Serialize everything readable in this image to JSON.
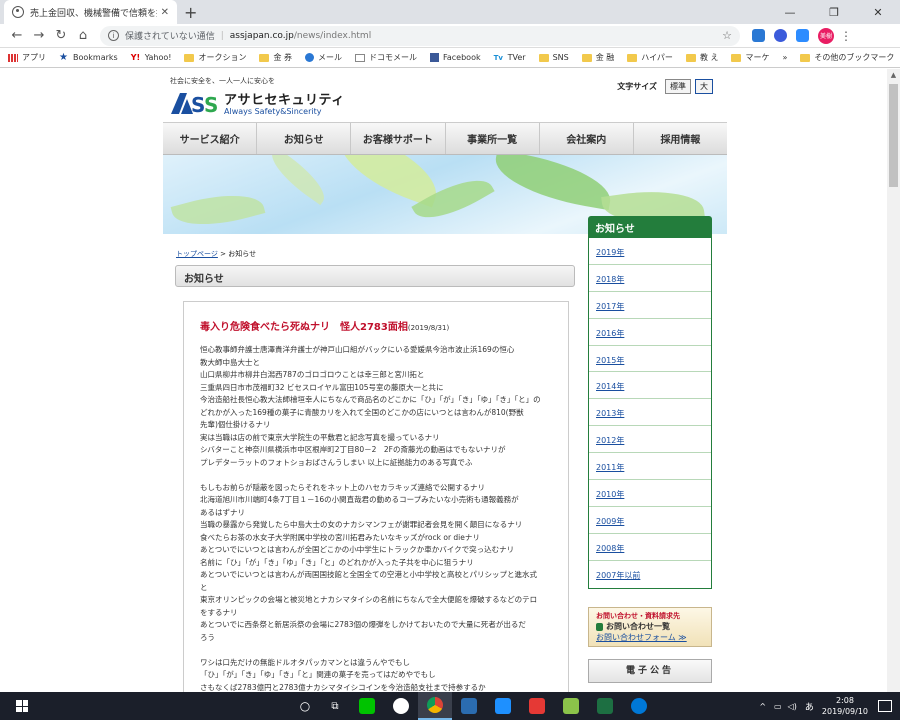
{
  "browser": {
    "tab_title": "売上金回収、機械警備で信頼を提",
    "omnibox": {
      "insecure": "保護されていない通信",
      "host": "assjapan.co.jp",
      "path": "/news/index.html"
    },
    "avatar_label": "美樹"
  },
  "bookmarks": [
    {
      "label": "アプリ",
      "icon": "apps-grid-icon"
    },
    {
      "label": "Bookmarks",
      "icon": "star-icon"
    },
    {
      "label": "Yahoo!",
      "icon": "yahoo-icon"
    },
    {
      "label": "オークション",
      "icon": "folder-icon"
    },
    {
      "label": "金 券",
      "icon": "folder-icon"
    },
    {
      "label": "メール",
      "icon": "mail-icon"
    },
    {
      "label": "ドコモメール",
      "icon": "docomo-mail-icon"
    },
    {
      "label": "Facebook",
      "icon": "facebook-icon"
    },
    {
      "label": "TVer",
      "icon": "tver-icon"
    },
    {
      "label": "SNS",
      "icon": "folder-icon"
    },
    {
      "label": "金 融",
      "icon": "folder-icon"
    },
    {
      "label": "ハイパー",
      "icon": "folder-icon"
    },
    {
      "label": "教 え",
      "icon": "folder-icon"
    },
    {
      "label": "マーケ",
      "icon": "folder-icon"
    }
  ],
  "bookmarks_other": "その他のブックマーク",
  "bookmarks_more": "»",
  "site": {
    "tagline": "社会に安全を、一人一人に安心を",
    "logo_jp": "アサヒセキュリティ",
    "logo_en": "Always Safety&Sincerity",
    "font_size_label": "文字サイズ",
    "font_std": "標準",
    "font_big": "大"
  },
  "gnav": [
    "サービス紹介",
    "お知らせ",
    "お客様サポート",
    "事業所一覧",
    "会社案内",
    "採用情報"
  ],
  "breadcrumb": {
    "home": "トップページ",
    "sep": " > ",
    "current": "お知らせ"
  },
  "section_title": "お知らせ",
  "article": {
    "title": "毒入り危険食べたら死ぬナリ　怪人2783面相",
    "date": "(2019/8/31)",
    "paragraphs": [
      [
        "恒心教事師弁護士唐澤貴洋弁護士が神戸山口組がバックにいる愛媛県今治市波止浜169の恒心",
        "教大師中島大士と",
        "山口県柳井市柳井白潟西787のゴロゴロウことは幸三郎と宮川拓と",
        "三重県四日市市茂福町32 ビセスロイヤル富田105号室の藤原大一と共に",
        "今治造船社長恒心教大法師檜垣幸人にちなんで商品名のどこかに「ひ」「が」「き」「ゆ」「き」「と」の",
        "どれかが入った169種の菓子に青酸カリを入れて全国のどこかの店にいつとは言わんが810(野獣",
        "先輩)個仕掛けるナリ",
        "実は当職は店の前で東京大学院生の平敷君と記念写真を撮っているナリ",
        "シバターこと神奈川県横浜市中区根岸町2丁目80－2　2Fの斎藤光の動画はでもないナリが",
        "プレデターラットのフォトショおばさんうしまい 以上に証拠能力のある写真でふ"
      ],
      [
        "もしもお前らが隠蔽を図ったらそれをネット上のハセカラキッズ連絡で公開するナリ",
        "北海道旭川市川端町4条7丁目１－16の小関直哉君の動めるコープみたいな小売術も通報義務が",
        "あるはずナリ",
        "当職の暴露から発覚したら中島大士の女のナカシマンフェが謝罪記者会見を開く顛目になるナリ",
        "食べたらお茶の水女子大学附属中学校の宮川拓君みたいなキッズがrock or dieナリ",
        "あとついでにいつとは言わんが全国どこかの小中学生にトラックか車かバイクで突っ込むナリ",
        "名前に「ひ」「が」「き」「ゆ」「き」「と」のどれかが入った子共を中心に狙うナリ",
        "あとついでにいつとは言わんが両国国技館と全国全ての空港と小中学校と高校とパリシップと進水式",
        "と",
        "東京オリンピックの会場と被災地とナカシマタイシの名前にちなんで全大便館を爆破するなどのテロ",
        "をするナリ",
        "あとついでに西条祭と新居浜祭の会場に2783個の爆弾をしかけておいたので大量に死者が出るだ",
        "ろう"
      ],
      [
        "ワシは口先だけの無能ドルオタパッカマンとは違うんやでもし",
        "「ひ」「が」「き」「ゆ」「き」「と」関連の菓子を売ってはだめやでもし",
        "さもなくば2783億円と2783億ナカシマタイシコインを今治造船支社まで持参するか"
      ]
    ]
  },
  "sidebar": {
    "title": "お知らせ",
    "years": [
      "2019年",
      "2018年",
      "2017年",
      "2016年",
      "2015年",
      "2014年",
      "2013年",
      "2012年",
      "2011年",
      "2010年",
      "2009年",
      "2008年",
      "2007年以前"
    ]
  },
  "contact": {
    "line1": "お問い合わせ・資料請求先",
    "line2": "お問い合わせ一覧",
    "line3": "お問い合わせフォーム ≫"
  },
  "e_announce": "電子公告",
  "taskbar": {
    "ime": "あ",
    "time": "2:08",
    "date": "2019/09/10"
  },
  "colors": {
    "accent_green": "#237d3c",
    "title_red": "#c0102c",
    "link_blue": "#1a4fa0"
  }
}
